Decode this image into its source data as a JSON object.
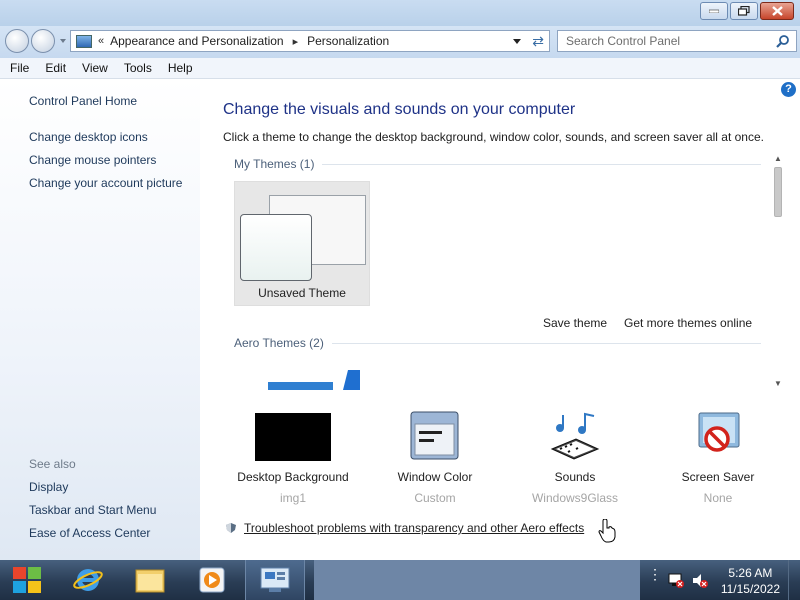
{
  "window": {
    "controls": {
      "minimize": "minimize",
      "maximize": "restore",
      "close": "close"
    }
  },
  "address": {
    "overflow": "«",
    "breadcrumb": [
      "Appearance and Personalization",
      "Personalization"
    ],
    "separator": "▸"
  },
  "search": {
    "placeholder": "Search Control Panel"
  },
  "menu": [
    "File",
    "Edit",
    "View",
    "Tools",
    "Help"
  ],
  "sidebar": {
    "home": "Control Panel Home",
    "tasks": [
      "Change desktop icons",
      "Change mouse pointers",
      "Change your account picture"
    ],
    "see_also_label": "See also",
    "see_also": [
      "Display",
      "Taskbar and Start Menu",
      "Ease of Access Center"
    ]
  },
  "main": {
    "help": "?",
    "title": "Change the visuals and sounds on your computer",
    "subtitle": "Click a theme to change the desktop background, window color, sounds, and screen saver all at once.",
    "groups": [
      {
        "label": "My Themes (1)",
        "themes": [
          {
            "name": "Unsaved Theme"
          }
        ]
      },
      {
        "label": "Aero Themes (2)"
      }
    ],
    "save_theme": "Save theme",
    "get_more": "Get more themes online",
    "settings": [
      {
        "name": "Desktop Background",
        "value": "img1",
        "icon": "black-desktop-icon"
      },
      {
        "name": "Window Color",
        "value": "Custom",
        "icon": "window-color-icon"
      },
      {
        "name": "Sounds",
        "value": "Windows9Glass",
        "icon": "sounds-icon"
      },
      {
        "name": "Screen Saver",
        "value": "None",
        "icon": "screen-saver-icon"
      }
    ],
    "troubleshoot": "Troubleshoot problems with transparency and other Aero effects"
  },
  "taskbar": {
    "apps": [
      "internet-explorer-icon",
      "file-explorer-icon",
      "media-player-icon",
      "control-panel-icon"
    ],
    "time": "5:26 AM",
    "date": "11/15/2022"
  },
  "colors": {
    "link": "#1e395b",
    "title": "#1e3287",
    "muted": "#a5a5a5"
  }
}
